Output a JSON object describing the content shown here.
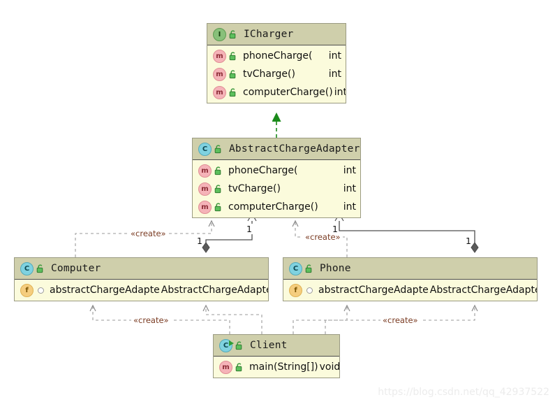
{
  "diagram": {
    "type": "uml-class-diagram",
    "background": "#ffffff",
    "watermark": "https://blog.csdn.net/qq_42937522"
  },
  "colors": {
    "header_fill": "#cfcfab",
    "body_fill": "#fbfbdc",
    "border": "#9a9a82",
    "realization_arrow": "#1a8a1a",
    "dependency_line": "#9a9a9a",
    "composition_line": "#4d4d4d",
    "stereotype_text": "#7a3b22",
    "watermark_text": "#ececec"
  },
  "classes": [
    {
      "id": "icharger",
      "name": "ICharger",
      "kind": "interface",
      "badge": "I",
      "visibility_icon": "unlock-icon",
      "members": [
        {
          "icon": "method-icon",
          "visibility_icon": "unlock-icon",
          "name": "phoneCharge(",
          "type": "int",
          "inline_type": false
        },
        {
          "icon": "method-icon",
          "visibility_icon": "unlock-icon",
          "name": "tvCharge()",
          "type": "int",
          "inline_type": false
        },
        {
          "icon": "method-icon",
          "visibility_icon": "unlock-icon",
          "name": "computerCharge()",
          "type": "int",
          "inline_type": true
        }
      ]
    },
    {
      "id": "abstractchargeadapter",
      "name": "AbstractChargeAdapter",
      "kind": "class",
      "badge": "C",
      "visibility_icon": "unlock-icon",
      "members": [
        {
          "icon": "method-icon",
          "visibility_icon": "unlock-icon",
          "name": "phoneCharge(",
          "type": "int",
          "inline_type": false
        },
        {
          "icon": "method-icon",
          "visibility_icon": "unlock-icon",
          "name": "tvCharge()",
          "type": "int",
          "inline_type": false
        },
        {
          "icon": "method-icon",
          "visibility_icon": "unlock-icon",
          "name": "computerCharge()",
          "type": "int",
          "inline_type": false
        }
      ]
    },
    {
      "id": "computer",
      "name": "Computer",
      "kind": "class",
      "badge": "C",
      "visibility_icon": "unlock-icon",
      "members": [
        {
          "icon": "field-icon",
          "visibility_icon": "package-private-dot",
          "name": "abstractChargeAdapte",
          "type": "AbstractChargeAdapter",
          "inline_type": true
        }
      ]
    },
    {
      "id": "phone",
      "name": "Phone",
      "kind": "class",
      "badge": "C",
      "visibility_icon": "unlock-icon",
      "members": [
        {
          "icon": "field-icon",
          "visibility_icon": "package-private-dot",
          "name": "abstractChargeAdapte",
          "type": "AbstractChargeAdapter",
          "inline_type": true
        }
      ]
    },
    {
      "id": "client",
      "name": "Client",
      "kind": "runnable-class",
      "badge": "C",
      "visibility_icon": "unlock-icon",
      "members": [
        {
          "icon": "method-icon",
          "visibility_icon": "unlock-icon",
          "name": "main(String[])",
          "type": "void",
          "inline_type": true
        }
      ]
    }
  ],
  "edges": [
    {
      "from": "abstractchargeadapter",
      "to": "icharger",
      "kind": "realization",
      "label": "",
      "multiplicity": ""
    },
    {
      "from": "computer",
      "to": "abstractchargeadapter",
      "kind": "dependency",
      "label": "«create»",
      "multiplicity": ""
    },
    {
      "from": "computer",
      "to": "abstractchargeadapter",
      "kind": "composition",
      "label": "",
      "multiplicity": "1"
    },
    {
      "from": "phone",
      "to": "abstractchargeadapter",
      "kind": "dependency",
      "label": "«create»",
      "multiplicity": ""
    },
    {
      "from": "phone",
      "to": "abstractchargeadapter",
      "kind": "composition",
      "label": "",
      "multiplicity": "1"
    },
    {
      "from": "client",
      "to": "computer",
      "kind": "dependency",
      "label": "«create»",
      "multiplicity": ""
    },
    {
      "from": "client",
      "to": "computer",
      "kind": "dependency",
      "label": "",
      "multiplicity": ""
    },
    {
      "from": "client",
      "to": "phone",
      "kind": "dependency",
      "label": "«create»",
      "multiplicity": ""
    },
    {
      "from": "client",
      "to": "phone",
      "kind": "dependency",
      "label": "",
      "multiplicity": ""
    }
  ],
  "edge_labels": {
    "create_left_top": "«create»",
    "create_right_top": "«create»",
    "create_left_bottom": "«create»",
    "create_right_bottom": "«create»",
    "mult_left_inner": "1",
    "mult_left_outer": "1",
    "mult_right_inner": "1",
    "mult_right_outer": "1"
  }
}
